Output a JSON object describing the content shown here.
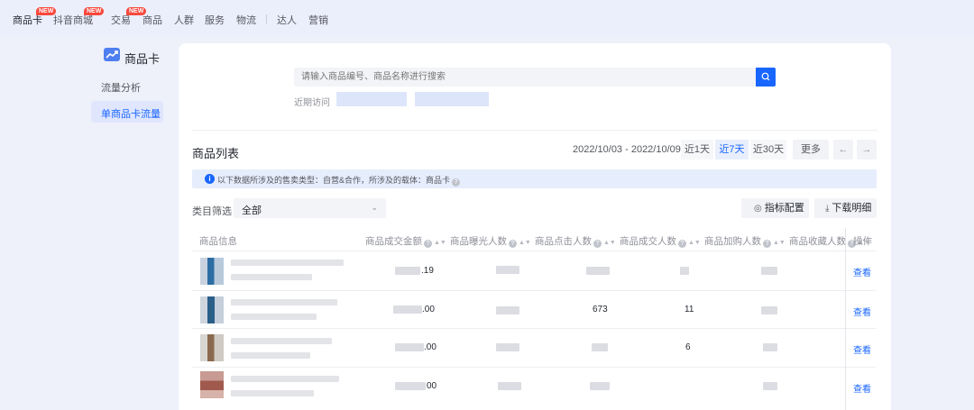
{
  "topnav": {
    "items": [
      {
        "label": "商品卡",
        "new": true
      },
      {
        "label": "抖音商城",
        "new": true
      },
      {
        "label": "交易",
        "new": true
      },
      {
        "label": "商品",
        "new": false
      },
      {
        "label": "人群",
        "new": false
      },
      {
        "label": "服务",
        "new": false
      },
      {
        "label": "物流",
        "new": false
      },
      {
        "label": "达人",
        "new": false
      },
      {
        "label": "营销",
        "new": false
      }
    ],
    "new_badge": "NEW"
  },
  "sidebar": {
    "title": "商品卡",
    "items": [
      {
        "label": "流量分析"
      },
      {
        "label": "单商品卡流量"
      }
    ]
  },
  "search": {
    "placeholder": "请输入商品编号、商品名称进行搜索",
    "recent_label": "近期访问"
  },
  "list": {
    "title": "商品列表",
    "date_range": "2022/10/03 - 2022/10/09",
    "periods": [
      "近1天",
      "近7天",
      "近30天"
    ],
    "more": "更多",
    "info": "以下数据所涉及的售卖类型：自营&合作，所涉及的载体：商品卡",
    "filter_label": "类目筛选",
    "filter_value": "全部",
    "metrics_button": "指标配置",
    "download_button": "下载明细"
  },
  "table": {
    "columns": [
      "商品信息",
      "商品成交金额",
      "商品曝光人数",
      "商品点击人数",
      "商品成交人数",
      "商品加购人数",
      "商品收藏人数",
      "操作"
    ],
    "rows": [
      {
        "amount_tail": ".19",
        "click_visible": "",
        "deal_visible": "",
        "action": "查看"
      },
      {
        "amount_tail": ".00",
        "click_visible": "673",
        "deal_visible": "11",
        "action": "查看"
      },
      {
        "amount_tail": ".00",
        "click_visible": "",
        "deal_visible": "6",
        "action": "查看"
      },
      {
        "amount_tail": "00",
        "click_visible": "",
        "deal_visible": "",
        "action": "查看"
      }
    ]
  }
}
